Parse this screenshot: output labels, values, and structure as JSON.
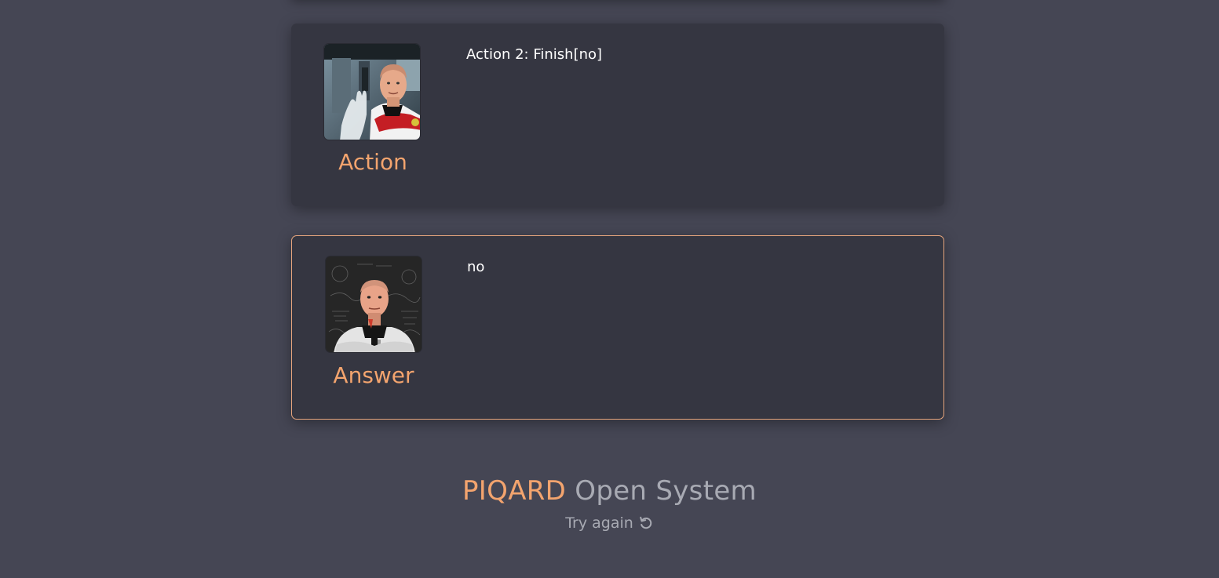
{
  "cards": [
    {
      "role": "Action",
      "text": "Action 2: Finish[no]",
      "avatar_icon": "captain-portrait-lab"
    },
    {
      "role": "Answer",
      "text": "no",
      "avatar_icon": "captain-portrait-chalkboard"
    }
  ],
  "footer": {
    "brand_accent": "PIQARD",
    "brand_rest": "Open System",
    "try_again": "Try again",
    "retry_icon": "rotate-ccw-icon"
  },
  "colors": {
    "background": "#454654",
    "card": "#353641",
    "accent": "#f3a46e",
    "answer_border": "#e7a67e",
    "muted_text": "#a8aab3"
  }
}
